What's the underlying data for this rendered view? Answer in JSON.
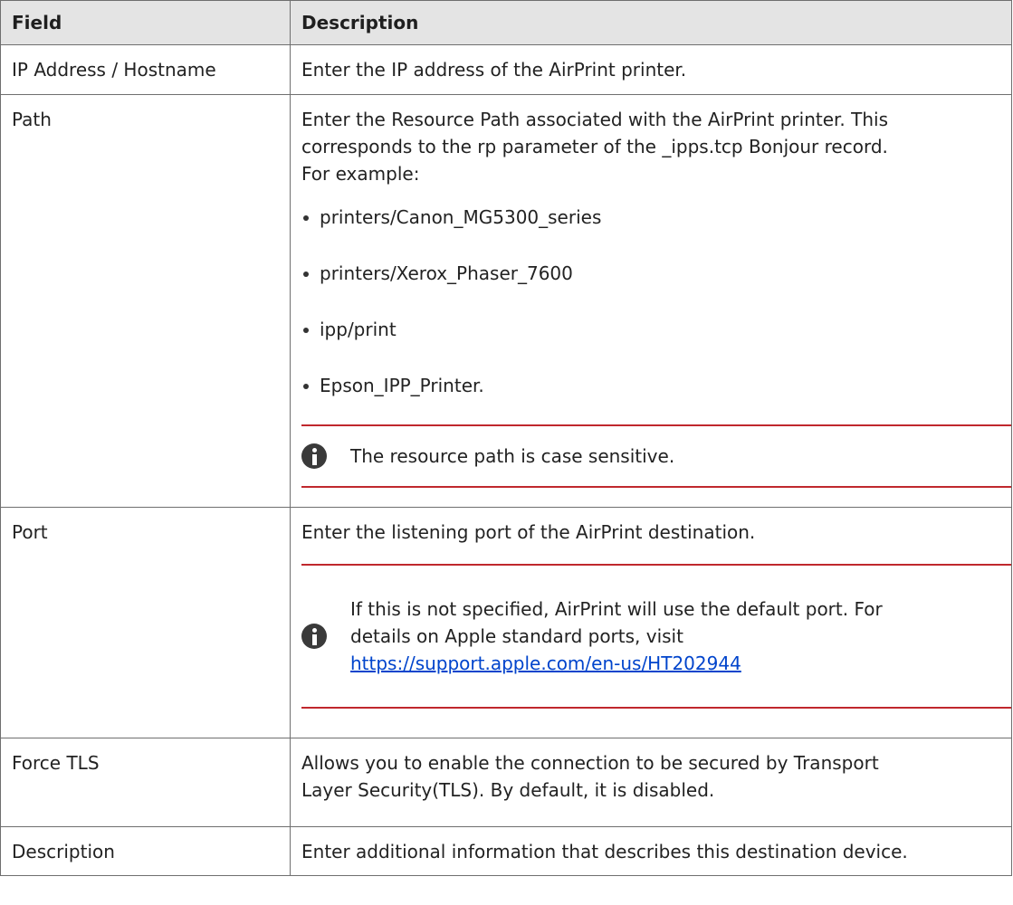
{
  "headers": {
    "field": "Field",
    "description": "Description"
  },
  "rows": {
    "ip": {
      "field": "IP Address / Hostname",
      "description": "Enter the IP address of the AirPrint printer."
    },
    "path": {
      "field": "Path",
      "line1": "Enter the Resource Path associated with the AirPrint printer. This",
      "line2": "corresponds to the rp parameter of the _ipps.tcp Bonjour record.",
      "line3": "For example:",
      "examples": [
        "printers/Canon_MG5300_series",
        "printers/Xerox_Phaser_7600",
        "ipp/print",
        "Epson_IPP_Printer."
      ],
      "note": "The resource path is case sensitive.",
      "note_icon": "info-icon"
    },
    "port": {
      "field": "Port",
      "description": "Enter the listening port of the AirPrint destination.",
      "note_line1": "If this is not specified, AirPrint will use the default port. For",
      "note_line2": "details on Apple standard ports, visit",
      "note_link": "https://support.apple.com/en-us/HT202944",
      "note_icon": "info-icon"
    },
    "tls": {
      "field": "Force TLS",
      "line1": "Allows you to enable the connection to be secured by Transport",
      "line2": "Layer Security(TLS). By default, it is disabled."
    },
    "description": {
      "field": "Description",
      "description": "Enter additional information that describes this destination device."
    }
  },
  "colors": {
    "note_rule": "#c0282d",
    "link": "#0044cc",
    "header_bg": "#e4e4e4"
  }
}
